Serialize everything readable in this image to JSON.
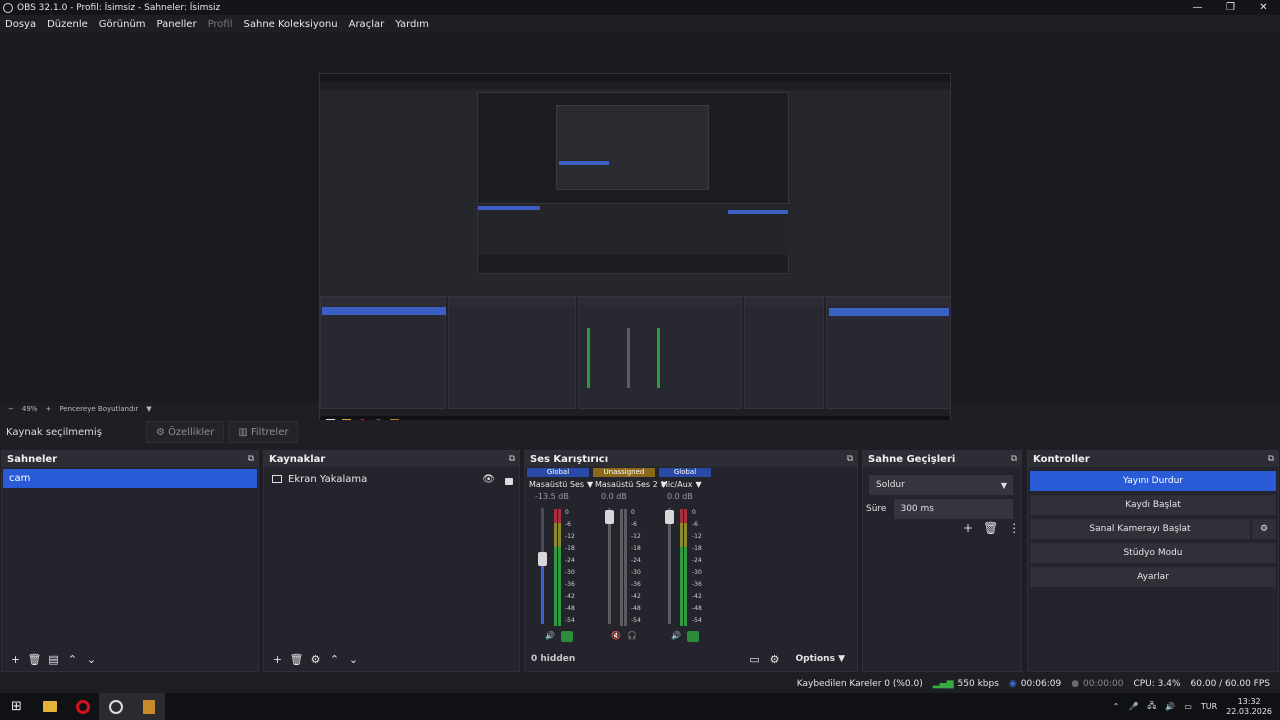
{
  "window": {
    "title": "OBS 32.1.0 - Profil: İsimsiz - Sahneler: İsimsiz",
    "controls": [
      "—",
      "❐",
      "✕"
    ]
  },
  "menu": [
    {
      "label": "Dosya"
    },
    {
      "label": "Düzenle"
    },
    {
      "label": "Görünüm"
    },
    {
      "label": "Paneller"
    },
    {
      "label": "Profil"
    },
    {
      "label": "Sahne Koleksiyonu"
    },
    {
      "label": "Araçlar"
    },
    {
      "label": "Yardım"
    }
  ],
  "zoom": {
    "minus": "−",
    "value": "49%",
    "plus": "+",
    "mode": "Pencereye Boyutlandır"
  },
  "context": {
    "no_source": "Kaynak seçilmemiş",
    "properties": "Özellikler",
    "filters": "Filtreler"
  },
  "scenes": {
    "title": "Sahneler",
    "items": [
      "cam"
    ]
  },
  "sources": {
    "title": "Kaynaklar",
    "items": [
      "Ekran Yakalama"
    ]
  },
  "mixer": {
    "title": "Ses Karıştırıcı",
    "hidden": "0 hidden",
    "options": "Options",
    "channels": [
      {
        "tag": "Global",
        "tag_color": "#2a4aa8",
        "name": "Masaüstü Ses",
        "db": "-13.5 dB",
        "level": 0.6
      },
      {
        "tag": "Unassigned",
        "tag_color": "#8a6a1a",
        "name": "Masaüstü Ses 2",
        "db": "0.0 dB",
        "level": 0.95
      },
      {
        "tag": "Global",
        "tag_color": "#2a4aa8",
        "name": "Mic/Aux",
        "db": "0.0 dB",
        "level": 0.95
      }
    ],
    "scale": [
      "0",
      "-6",
      "-12",
      "-18",
      "-24",
      "-30",
      "-36",
      "-42",
      "-48",
      "-54",
      "-60"
    ]
  },
  "transitions": {
    "title": "Sahne Geçişleri",
    "type": "Soldur",
    "duration_label": "Süre",
    "duration": "300 ms"
  },
  "controls": {
    "title": "Kontroller",
    "stop_stream": "Yayını Durdur",
    "start_record": "Kaydı Başlat",
    "virtual_cam": "Sanal Kamerayı Başlat",
    "studio_mode": "Stüdyo Modu",
    "settings": "Ayarlar"
  },
  "status": {
    "dropped": "Kaybedilen Kareler 0 (%0.0)",
    "bitrate": "550 kbps",
    "stream_time": "00:06:09",
    "rec_time": "00:00:00",
    "cpu": "CPU: 3.4%",
    "fps": "60.00 / 60.00 FPS"
  },
  "taskbar": {
    "lang": "TUR",
    "time": "13:32",
    "date": "22.03.2026"
  },
  "colors": {
    "accent": "#2a5bd7",
    "bg": "#1e1f24",
    "dock": "#24252c"
  }
}
